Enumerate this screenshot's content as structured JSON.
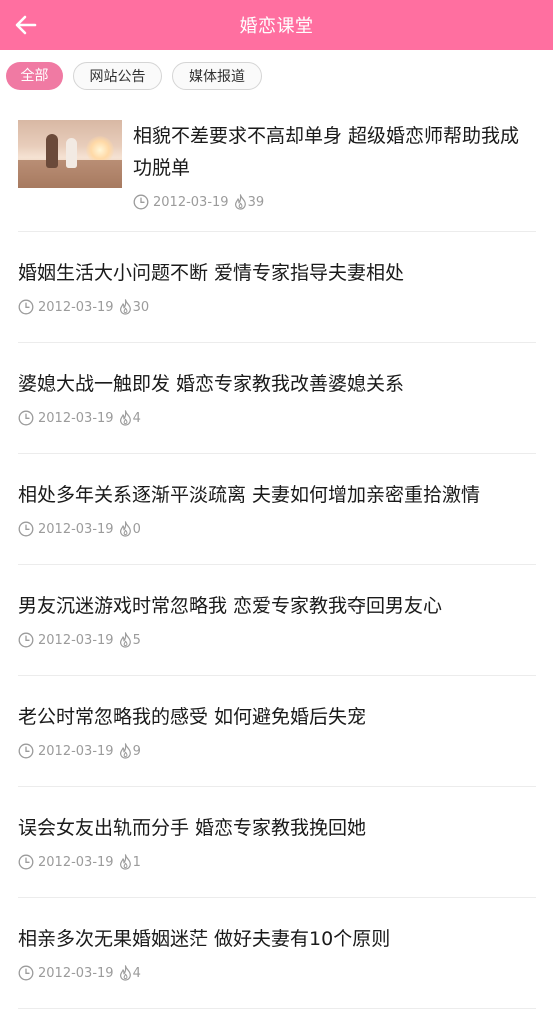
{
  "header": {
    "title": "婚恋课堂",
    "background_color": "#ff6fa0"
  },
  "tabs": [
    {
      "label": "全部",
      "active": true
    },
    {
      "label": "网站公告",
      "active": false
    },
    {
      "label": "媒体报道",
      "active": false
    }
  ],
  "articles": [
    {
      "title": "相貌不差要求不高却单身 超级婚恋师帮助我成功脱单",
      "date": "2012-03-19",
      "views": "39",
      "has_thumbnail": true
    },
    {
      "title": "婚姻生活大小问题不断 爱情专家指导夫妻相处",
      "date": "2012-03-19",
      "views": "30"
    },
    {
      "title": "婆媳大战一触即发 婚恋专家教我改善婆媳关系",
      "date": "2012-03-19",
      "views": "4"
    },
    {
      "title": "相处多年关系逐渐平淡疏离 夫妻如何增加亲密重拾激情",
      "date": "2012-03-19",
      "views": "0"
    },
    {
      "title": "男友沉迷游戏时常忽略我 恋爱专家教我夺回男友心",
      "date": "2012-03-19",
      "views": "5"
    },
    {
      "title": "老公时常忽略我的感受 如何避免婚后失宠",
      "date": "2012-03-19",
      "views": "9"
    },
    {
      "title": "误会女友出轨而分手 婚恋专家教我挽回她",
      "date": "2012-03-19",
      "views": "1"
    },
    {
      "title": "相亲多次无果婚姻迷茫 做好夫妻有10个原则",
      "date": "2012-03-19",
      "views": "4"
    }
  ],
  "icons": {
    "back": "back-arrow-icon",
    "date": "clock-icon",
    "views": "fire-icon"
  },
  "colors": {
    "accent": "#ff6fa0",
    "active_tab": "#f07aa3",
    "meta_text": "#9b9b9b"
  }
}
